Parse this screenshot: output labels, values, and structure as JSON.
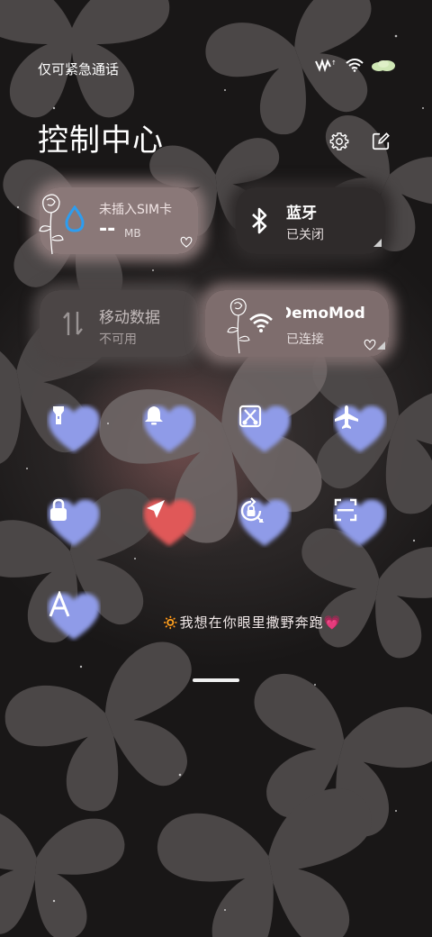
{
  "status_bar": {
    "carrier_text": "仅可紧急通话",
    "icons": [
      "signal-activity-icon",
      "wifi-icon",
      "battery-icon"
    ]
  },
  "header": {
    "title": "控制中心",
    "settings_icon": "gear-icon",
    "edit_icon": "edit-icon"
  },
  "tiles": {
    "sim": {
      "name": "未插入SIM卡",
      "value": "--",
      "unit": "MB",
      "icon": "water-drop-icon"
    },
    "bluetooth": {
      "name": "蓝牙",
      "status": "已关闭",
      "icon": "bluetooth-icon"
    },
    "mobile_data": {
      "name": "移动数据",
      "status": "不可用",
      "icon": "data-arrows-icon"
    },
    "wifi": {
      "name": "DemoMod",
      "status": "已连接",
      "icon": "wifi-icon"
    }
  },
  "toggles": [
    {
      "id": "flashlight",
      "icon": "flashlight-icon",
      "active": false
    },
    {
      "id": "ring",
      "icon": "bell-icon",
      "active": false
    },
    {
      "id": "screenshot",
      "icon": "screenshot-scissors-icon",
      "active": false
    },
    {
      "id": "airplane",
      "icon": "airplane-icon",
      "active": false
    },
    {
      "id": "lock-screen",
      "icon": "lock-icon",
      "active": false
    },
    {
      "id": "location",
      "icon": "location-arrow-icon",
      "active": true
    },
    {
      "id": "auto-rotate",
      "icon": "rotation-lock-icon",
      "active": false
    },
    {
      "id": "scanner",
      "icon": "scan-icon",
      "active": false
    },
    {
      "id": "font",
      "icon": "letter-a-icon",
      "active": false
    }
  ],
  "slogan": "🔅我想在你眼里撒野奔跑💗",
  "colors": {
    "heart_default": "#8f9be8",
    "heart_active": "#e05858"
  }
}
